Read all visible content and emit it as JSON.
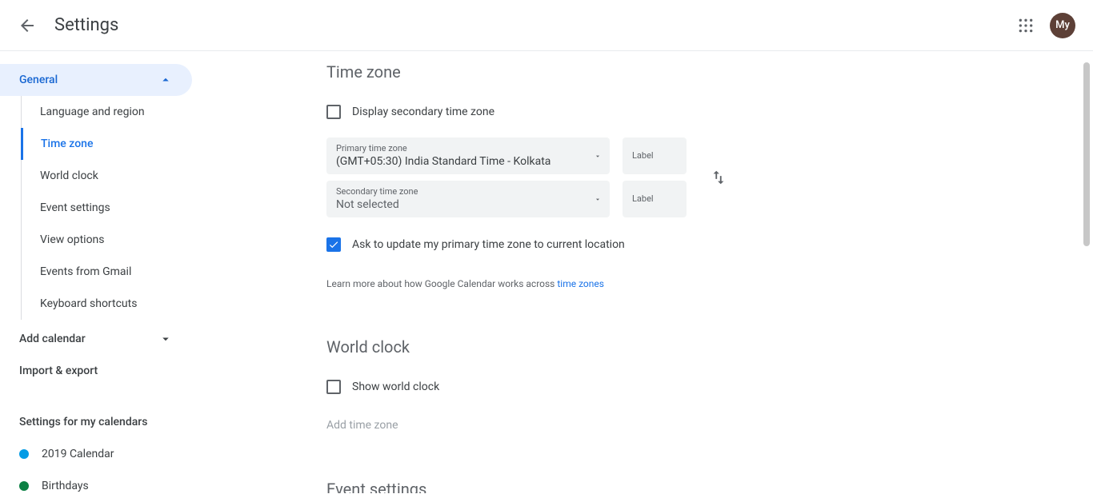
{
  "header": {
    "title": "Settings",
    "avatar_text": "My"
  },
  "sidebar": {
    "general": "General",
    "items": [
      "Language and region",
      "Time zone",
      "World clock",
      "Event settings",
      "View options",
      "Events from Gmail",
      "Keyboard shortcuts"
    ],
    "add_calendar": "Add calendar",
    "import_export": "Import & export",
    "settings_heading": "Settings for my calendars",
    "calendars": [
      {
        "name": "2019 Calendar",
        "color": "#039be5"
      },
      {
        "name": "Birthdays",
        "color": "#0b8043"
      }
    ]
  },
  "timezone": {
    "title": "Time zone",
    "display_secondary": "Display secondary time zone",
    "primary_label": "Primary time zone",
    "primary_value": "(GMT+05:30) India Standard Time - Kolkata",
    "secondary_label": "Secondary time zone",
    "secondary_value": "Not selected",
    "label_text": "Label",
    "ask_update": "Ask to update my primary time zone to current location",
    "help_prefix": "Learn more about how Google Calendar works across ",
    "help_link": "time zones"
  },
  "worldclock": {
    "title": "World clock",
    "show": "Show world clock",
    "add": "Add time zone"
  },
  "events": {
    "title": "Event settings"
  }
}
